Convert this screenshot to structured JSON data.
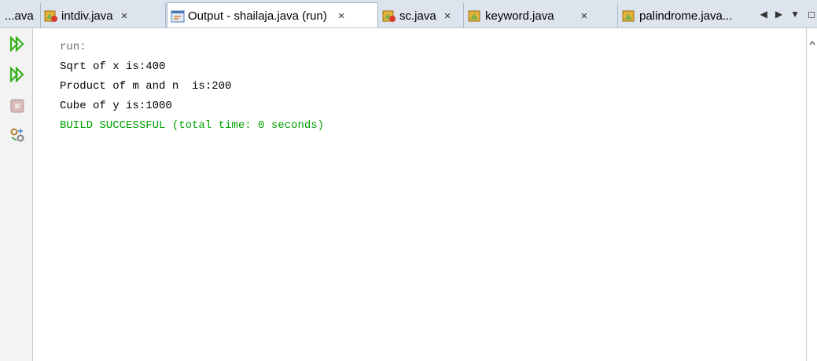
{
  "tabs": [
    {
      "label": "...ava",
      "active": false,
      "has_close": false,
      "icon": "java-class-icon"
    },
    {
      "label": "intdiv.java",
      "active": false,
      "has_close": true,
      "icon": "java-main-class-icon"
    },
    {
      "label": "Output - shailaja.java (run)",
      "active": true,
      "has_close": true,
      "icon": "output-window-icon"
    },
    {
      "label": "sc.java",
      "active": false,
      "has_close": true,
      "icon": "java-main-class-icon"
    },
    {
      "label": "keyword.java",
      "active": false,
      "has_close": true,
      "icon": "java-class-icon"
    },
    {
      "label": "palindrome.java...",
      "active": false,
      "has_close": false,
      "icon": "java-class-icon"
    }
  ],
  "tab_close_glyph": "×",
  "tab_nav": {
    "prev": "◀",
    "next": "▶",
    "menu": "▼",
    "restore": "◻"
  },
  "toolbar": {
    "rerun": "rerun-icon",
    "rerun_with_options": "rerun-with-options-icon",
    "stop": "stop-icon",
    "settings": "run-settings-icon"
  },
  "output_lines": [
    {
      "text": "run:",
      "style": "dim"
    },
    {
      "text": "Sqrt of x is:400",
      "style": "normal"
    },
    {
      "text": "Product of m and n  is:200",
      "style": "normal"
    },
    {
      "text": "Cube of y is:1000",
      "style": "normal"
    },
    {
      "text": "BUILD SUCCESSFUL (total time: 0 seconds)",
      "style": "success"
    }
  ],
  "colors": {
    "success": "#00a000",
    "dim": "#6f6f6f",
    "tabbar_bg": "#dde4ee",
    "rerun_green": "#37b01e",
    "stop_gray": "#c9a5a5"
  }
}
